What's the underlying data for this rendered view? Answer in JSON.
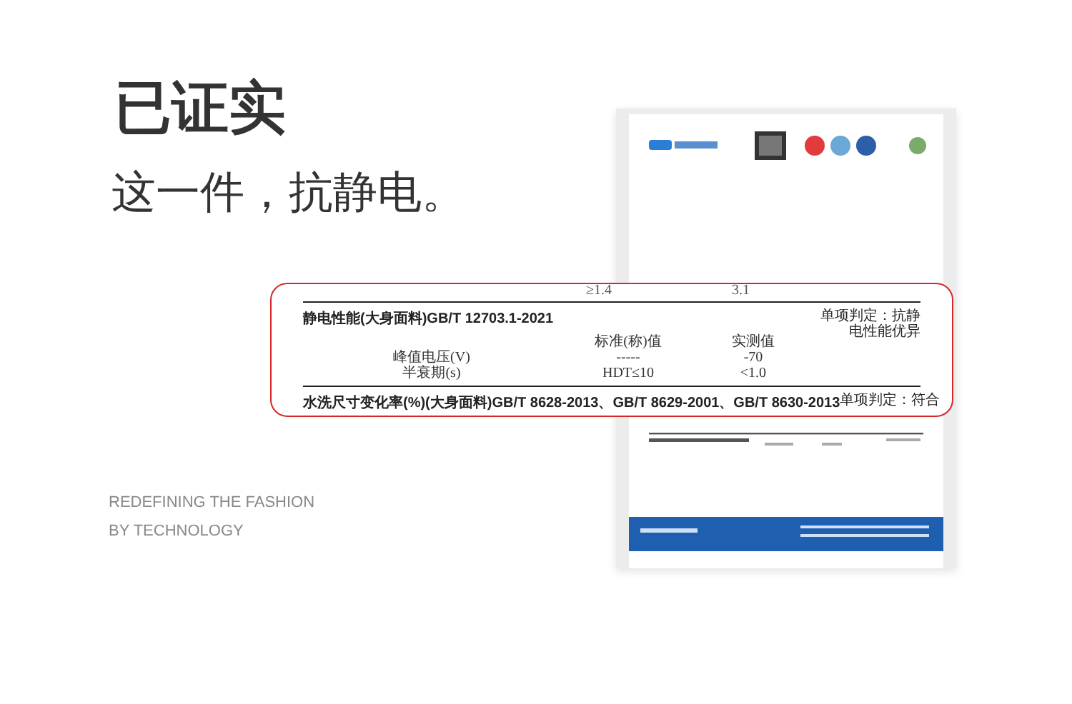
{
  "headline": "已证实",
  "subheadline": "这一件，抗静电。",
  "tagline": [
    "REDEFINING THE FASHION",
    "BY TECHNOLOGY"
  ],
  "callout": {
    "prev_values": [
      "≥1.4",
      "3.1"
    ],
    "sections": [
      {
        "title": "静电性能(大身面料)GB/T 12703.1-2021",
        "verdict": "单项判定：抗静电性能优异",
        "columns": [
          "标准(称)值",
          "实测值"
        ],
        "rows": [
          {
            "label": "峰值电压(V)",
            "values": [
              "-----",
              "-70"
            ]
          },
          {
            "label": "半衰期(s)",
            "values": [
              "HDT≤10",
              "<1.0"
            ]
          }
        ]
      },
      {
        "title": "水洗尺寸变化率(%)(大身面料)GB/T 8628-2013、GB/T 8629-2001、GB/T 8630-2013",
        "verdict": "单项判定：符合"
      }
    ]
  }
}
